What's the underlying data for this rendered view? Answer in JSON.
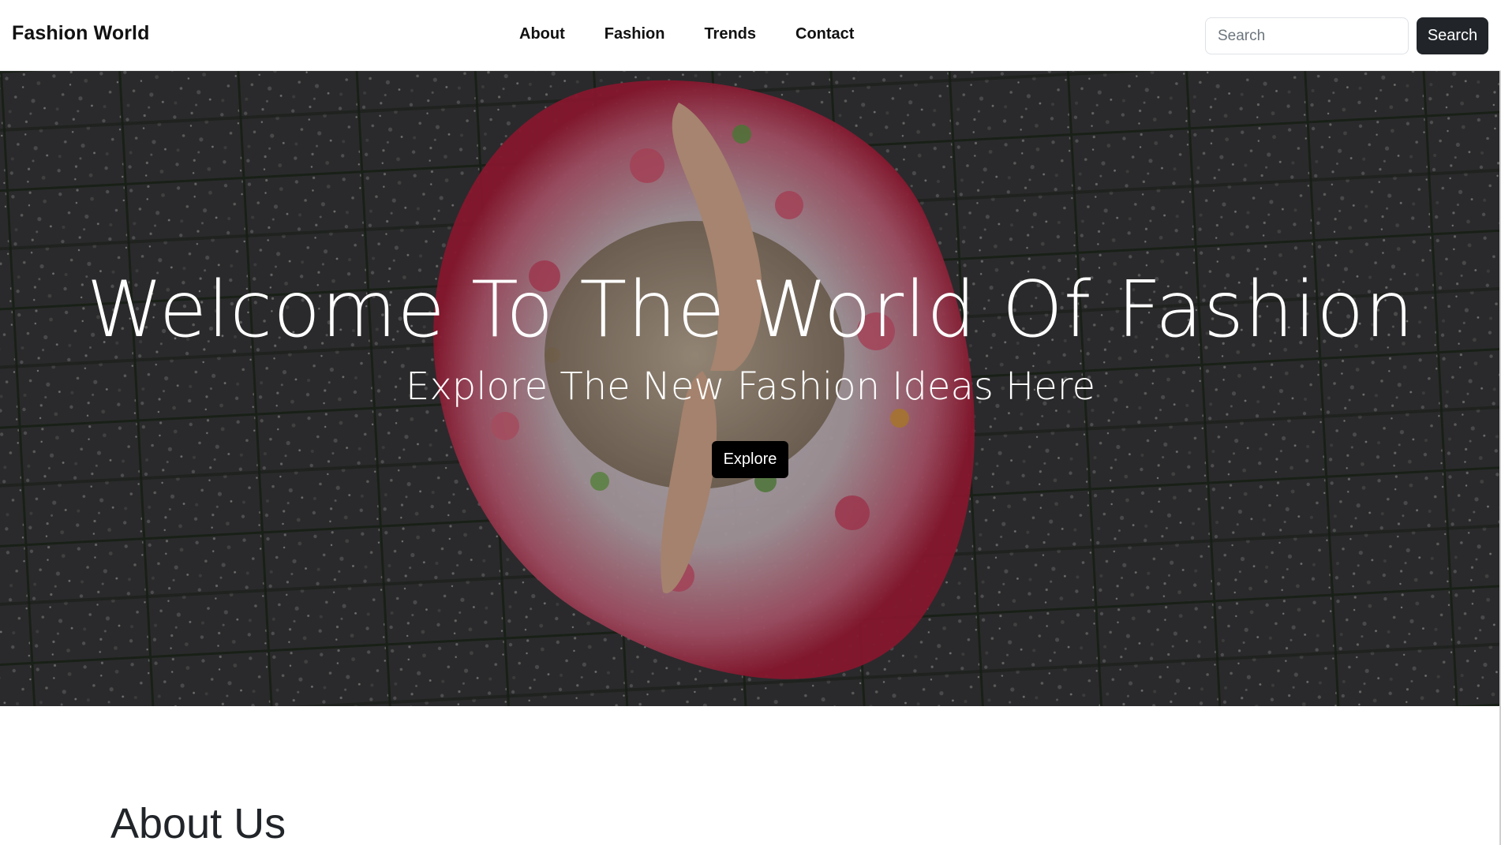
{
  "navbar": {
    "brand": "Fashion World",
    "links": [
      "About",
      "Fashion",
      "Trends",
      "Contact"
    ],
    "search_placeholder": "Search",
    "search_value": "",
    "search_button": "Search"
  },
  "hero": {
    "title": "Welcome To The World Of Fashion",
    "subtitle": "Explore The New Fashion Ideas Here",
    "button_label": "Explore",
    "image_icon": "hero-photo-girl-spinning-floral-dress-on-pavement"
  },
  "about": {
    "heading": "About Us"
  },
  "colors": {
    "navbar_bg": "#ffffff",
    "button_dark": "#212529",
    "explore_button": "#000000",
    "hero_text": "#ffffff"
  }
}
